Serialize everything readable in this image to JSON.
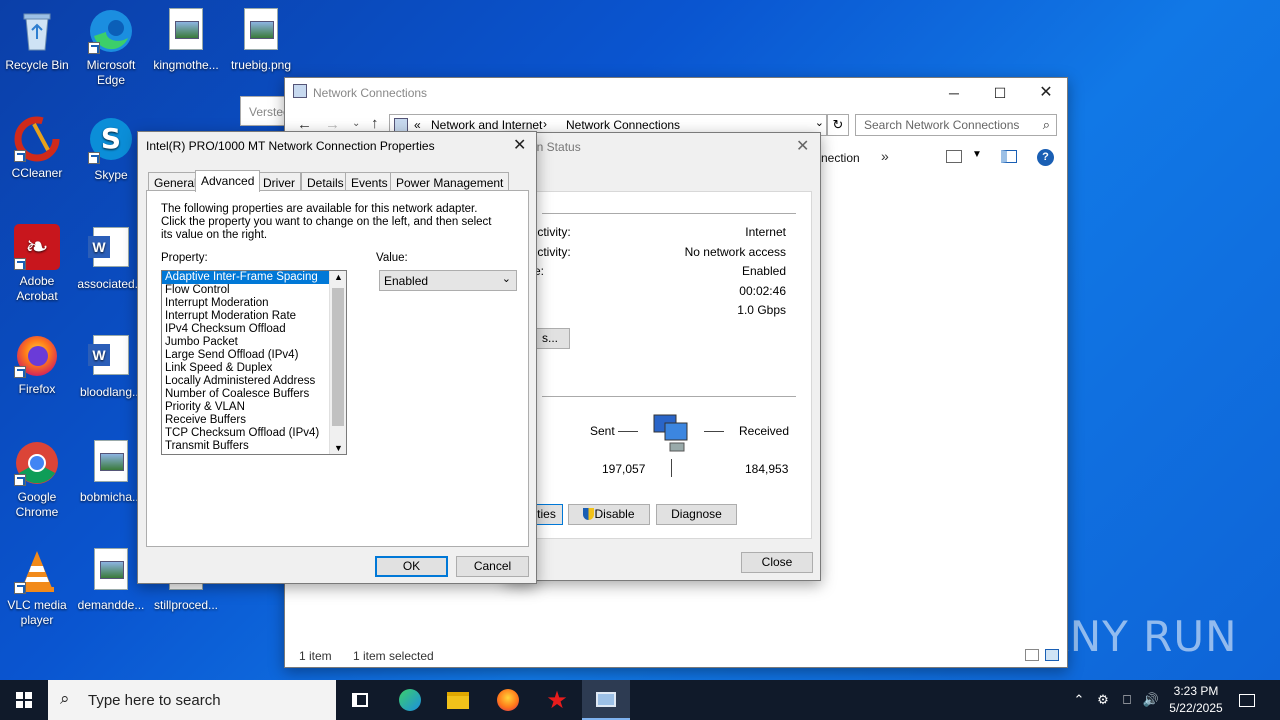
{
  "desktop": {
    "icons": [
      {
        "label": "Recycle Bin"
      },
      {
        "label": "Microsoft Edge"
      },
      {
        "label": "kingmothe..."
      },
      {
        "label": "truebig.png"
      },
      {
        "label": "CCleaner"
      },
      {
        "label": "Skype"
      },
      {
        "label": "Adobe Acrobat"
      },
      {
        "label": "associated..."
      },
      {
        "label": "Firefox"
      },
      {
        "label": "bloodlang..."
      },
      {
        "label": "Google Chrome"
      },
      {
        "label": "bobmicha..."
      },
      {
        "label": "VLC media player"
      },
      {
        "label": "demandde..."
      },
      {
        "label": "stillproced..."
      }
    ],
    "partial_window_label": "Versteck",
    "watermark": "ANY RUN"
  },
  "explorer": {
    "title": "Network Connections",
    "breadcrumb": {
      "prefix": "«",
      "items": [
        "Network and Internet",
        "Network Connections"
      ]
    },
    "search_placeholder": "Search Network Connections",
    "toolbar_partial": "nection",
    "toolbar_more": "»",
    "status_items": "1 item",
    "status_selected": "1 item selected"
  },
  "status_dialog": {
    "title_partial": "on Status",
    "rows": [
      {
        "label": "nectivity:",
        "value": "Internet"
      },
      {
        "label": "nectivity:",
        "value": "No network access"
      },
      {
        "label": "ate:",
        "value": "Enabled"
      },
      {
        "label": ":",
        "value": "00:02:46"
      },
      {
        "label": "",
        "value": "1.0 Gbps"
      }
    ],
    "details_button": "s...",
    "sent_label": "Sent",
    "received_label": "Received",
    "sent_value": "197,057",
    "received_value": "184,953",
    "properties_button": "ties",
    "disable_button": "Disable",
    "diagnose_button": "Diagnose",
    "close_button": "Close"
  },
  "props": {
    "title": "Intel(R) PRO/1000 MT Network Connection Properties",
    "tabs": [
      "General",
      "Advanced",
      "Driver",
      "Details",
      "Events",
      "Power Management"
    ],
    "active_tab": "Advanced",
    "description": "The following properties are available for this network adapter. Click the property you want to change on the left, and then select its value on the right.",
    "property_label": "Property:",
    "value_label": "Value:",
    "properties": [
      "Adaptive Inter-Frame Spacing",
      "Flow Control",
      "Interrupt Moderation",
      "Interrupt Moderation Rate",
      "IPv4 Checksum Offload",
      "Jumbo Packet",
      "Large Send Offload (IPv4)",
      "Link Speed & Duplex",
      "Locally Administered Address",
      "Number of Coalesce Buffers",
      "Priority & VLAN",
      "Receive Buffers",
      "TCP Checksum Offload (IPv4)",
      "Transmit Buffers"
    ],
    "selected_property": "Adaptive Inter-Frame Spacing",
    "value_selected": "Enabled",
    "ok_button": "OK",
    "cancel_button": "Cancel"
  },
  "taskbar": {
    "search_placeholder": "Type here to search",
    "time": "3:23 PM",
    "date": "5/22/2025"
  },
  "colors": {
    "accent": "#0078d7",
    "taskbar": "#101a2a",
    "desktop": "#0a55d0"
  }
}
